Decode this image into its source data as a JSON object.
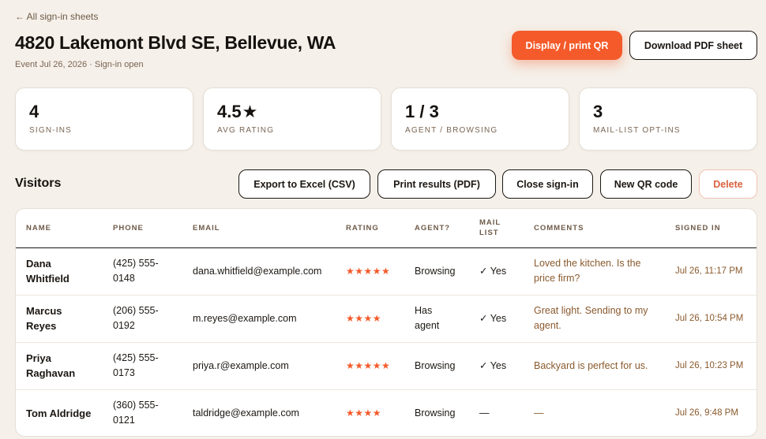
{
  "nav": {
    "back_label": "← All sign-in sheets"
  },
  "header": {
    "title": "4820 Lakemont Blvd SE, Bellevue, WA",
    "subtitle": "Event Jul 26, 2026 · Sign-in open",
    "primary_button": "Display / print QR",
    "secondary_button": "Download PDF sheet"
  },
  "stats": [
    {
      "value": "4",
      "label": "SIGN-INS"
    },
    {
      "value": "4.5",
      "label": "AVG RATING",
      "icon": "star-icon"
    },
    {
      "value": "1 / 3",
      "label": "AGENT / BROWSING"
    },
    {
      "value": "3",
      "label": "MAIL-LIST OPT-INS"
    }
  ],
  "visitors": {
    "title": "Visitors",
    "actions": {
      "export": "Export to Excel (CSV)",
      "print": "Print results (PDF)",
      "close": "Close sign-in",
      "new_qr": "New QR code",
      "delete": "Delete"
    },
    "columns": {
      "name": "NAME",
      "phone": "PHONE",
      "email": "EMAIL",
      "rating": "RATING",
      "agent": "AGENT?",
      "mail_line1": "MAIL",
      "mail_line2": "LIST",
      "comments": "COMMENTS",
      "signed": "SIGNED IN"
    },
    "rows": [
      {
        "name_line1": "Dana",
        "name_line2": "Whitfield",
        "phone_line1": "(425) 555-",
        "phone_line2": "0148",
        "email": "dana.whitfield@example.com",
        "rating": 5,
        "rating_stars": "★★★★★",
        "agent_line1": "Browsing",
        "agent_line2": "",
        "mail_list": "✓ Yes",
        "comment_line1": "Loved the kitchen. Is the",
        "comment_line2": "price firm?",
        "signed_in": "Jul 26, 11:17 PM"
      },
      {
        "name_line1": "Marcus",
        "name_line2": "Reyes",
        "phone_line1": "(206) 555-",
        "phone_line2": "0192",
        "email": "m.reyes@example.com",
        "rating": 4,
        "rating_stars": "★★★★",
        "agent_line1": "Has",
        "agent_line2": "agent",
        "mail_list": "✓ Yes",
        "comment_line1": "Great light. Sending to my",
        "comment_line2": "agent.",
        "signed_in": "Jul 26, 10:54 PM"
      },
      {
        "name_line1": "Priya",
        "name_line2": "Raghavan",
        "phone_line1": "(425) 555-",
        "phone_line2": "0173",
        "email": "priya.r@example.com",
        "rating": 5,
        "rating_stars": "★★★★★",
        "agent_line1": "Browsing",
        "agent_line2": "",
        "mail_list": "✓ Yes",
        "comment_line1": "Backyard is perfect for us.",
        "comment_line2": "",
        "signed_in": "Jul 26, 10:23 PM"
      },
      {
        "name_line1": "Tom Aldridge",
        "name_line2": "",
        "phone_line1": "(360) 555-",
        "phone_line2": "0121",
        "email": "taldridge@example.com",
        "rating": 4,
        "rating_stars": "★★★★",
        "agent_line1": "Browsing",
        "agent_line2": "",
        "mail_list": "—",
        "comment_line1": "—",
        "comment_line2": "",
        "signed_in": "Jul 26, 9:48 PM"
      }
    ]
  },
  "colors": {
    "accent": "#f45a2a",
    "background": "#f5f0e9",
    "muted_text": "#8a5a2e",
    "danger": "#d9623e"
  }
}
